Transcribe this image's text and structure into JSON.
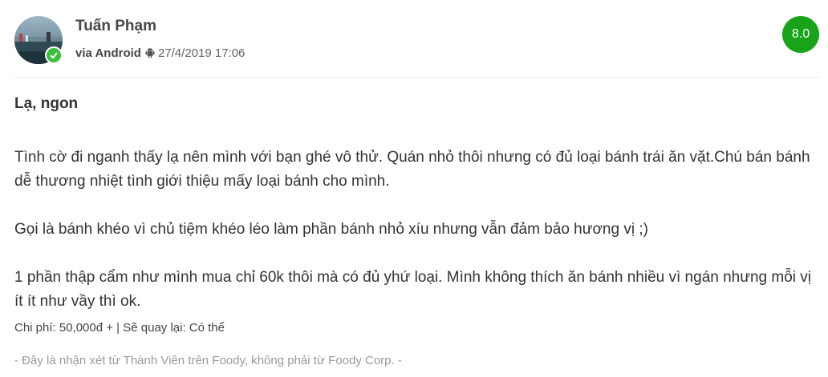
{
  "review": {
    "user": {
      "name": "Tuấn Phạm",
      "avatar": "avatar",
      "verified_icon": "verified-check-icon",
      "via": "via Android",
      "platform_icon": "android-icon",
      "date": "27/4/2019 17:06"
    },
    "score": "8.0",
    "title": "Lạ, ngon",
    "paragraphs": [
      "Tình cờ đi nganh thấy lạ nên mình với bạn ghé vô thử. Quán nhỏ thôi nhưng có đủ loại bánh trái ăn vặt.Chú bán bánh dễ thương nhiệt tình giới thiệu mấy loại bánh cho mình.",
      "Gọi là bánh khéo vì chủ tiệm khéo léo làm phần bánh nhỏ xíu nhưng vẫn đảm bảo hương vị ;)",
      "1 phần thập cẩm như mình mua chỉ 60k thôi mà có đủ yhứ loại. Mình không thích ăn bánh nhiều vì ngán nhưng mỗi vị ít ít như vầy thì ok."
    ],
    "cost_line": "Chi phí: 50,000đ + | Sẽ quay lại: Có thể",
    "disclaimer": "- Đây là nhận xét từ Thành Viên trên Foody, không phải từ Foody Corp. -"
  },
  "colors": {
    "score_bg": "#18a318",
    "verified": "#3cbf3c",
    "divider": "#ececec",
    "muted_text": "#9a9a9a"
  }
}
